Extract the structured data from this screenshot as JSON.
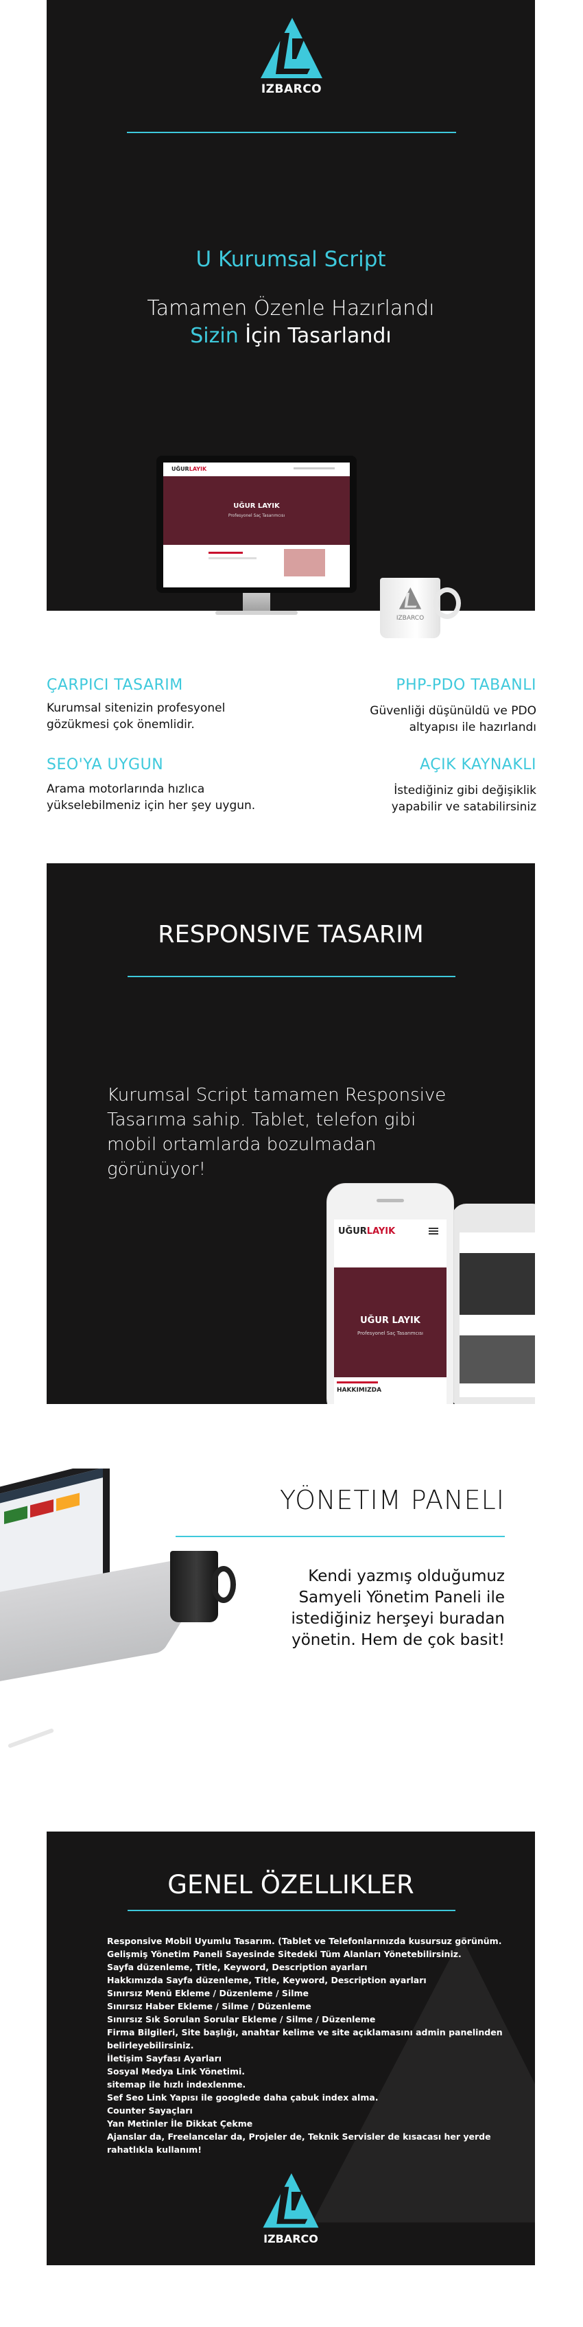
{
  "brand": {
    "logo_text": "IZBARCO",
    "accent": "#3ec9dc",
    "dark": "#171616"
  },
  "hero": {
    "title": "U Kurumsal Script",
    "line1": "Tamamen Özenle Hazırlandı",
    "line2_highlight": "Sizin",
    "line2_rest": " İçin Tasarlandı",
    "monitor_brand_1": "UĞUR",
    "monitor_brand_2": "LAYIK",
    "monitor_title": "UĞUR LAYIK",
    "monitor_subtitle": "Profesyonel Saç Tasarımcısı",
    "mug_text": "IZBARCO"
  },
  "features": [
    {
      "title": "ÇARPICI TASARIM",
      "text": "Kurumsal sitenizin profesyonel gözükmesi çok önemlidir."
    },
    {
      "title": "PHP-PDO TABANLI",
      "text": "Güvenliği düşünüldü ve PDO altyapısı ile hazırlandı"
    },
    {
      "title": "SEO'YA UYGUN",
      "text": "Arama motorlarında hızlıca yükselebilmeniz için her şey uygun."
    },
    {
      "title": "AÇIK KAYNAKLI",
      "text": "İstediğiniz gibi değişiklik yapabilir ve satabilirsiniz"
    }
  ],
  "responsive": {
    "title": "RESPONSIVE TASARIM",
    "text": "Kurumsal Script tamamen Responsive Tasarıma sahip. Tablet, telefon gibi mobil ortamlarda bozulmadan görünüyor!",
    "phone_brand_1": "UĞUR",
    "phone_brand_2": "LAYIK",
    "phone_title": "UĞUR LAYIK",
    "phone_subtitle": "Profesyonel Saç Tasarımcısı",
    "phone_section": "HAKKIMIZDA"
  },
  "admin": {
    "title": "YÖNETIM PANELI",
    "text": "Kendi yazmış olduğumuz Samyeli Yönetim Paneli ile istediğiniz herşeyi buradan yönetin. Hem de çok basit!"
  },
  "general": {
    "title": "GENEL ÖZELLIKLER",
    "items": [
      "Responsive Mobil Uyumlu Tasarım. (Tablet ve Telefonlarınızda kusursuz görünüm.",
      "Gelişmiş Yönetim Paneli Sayesinde Sitedeki Tüm Alanları Yönetebilirsiniz.",
      "Sayfa düzenleme, Title, Keyword, Description ayarları",
      "Hakkımızda Sayfa düzenleme, Title, Keyword, Description ayarları",
      "Sınırsız Menü Ekleme / Düzenleme / Silme",
      "Sınırsız Haber Ekleme / Silme / Düzenleme",
      "Sınırsız Sık Sorulan Sorular Ekleme / Silme / Düzenleme",
      "Firma Bilgileri, Site başlığı, anahtar kelime ve site açıklamasını admin panelinden belirleyebilirsiniz.",
      "İletişim Sayfası Ayarları",
      "Sosyal Medya Link Yönetimi.",
      "sitemap ile hızlı indexlenme.",
      "Sef Seo Link Yapısı ile googlede daha çabuk index alma.",
      "Counter Sayaçları",
      "Yan Metinler İle Dikkat Çekme",
      "Ajanslar da, Freelancelar da, Projeler de, Teknik Servisler de kısacası her yerde rahatlıkla kullanım!"
    ],
    "logo_text": "IZBARCO"
  }
}
